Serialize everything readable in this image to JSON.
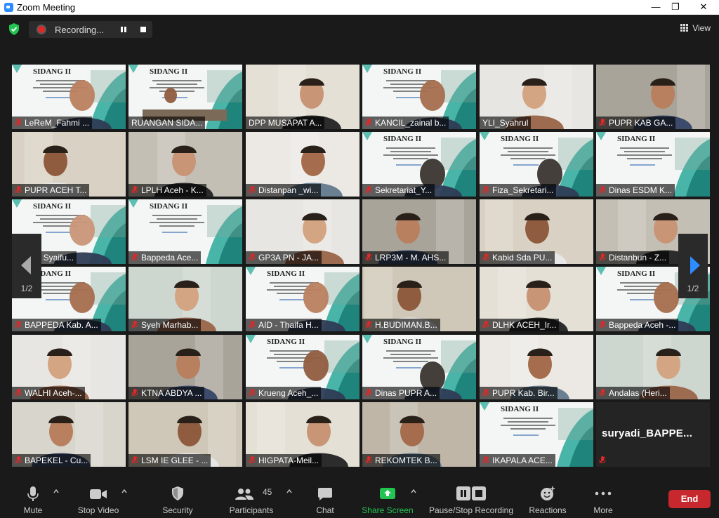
{
  "window": {
    "title": "Zoom Meeting",
    "minimize": "—",
    "maximize": "❐",
    "close": "✕"
  },
  "topbar": {
    "recording": "Recording...",
    "view": "View"
  },
  "pager": {
    "left": "1/2",
    "right": "1/2"
  },
  "slide_text": "SIDANG II",
  "participants": [
    "LeReM_Fahmi ...",
    "RUANGAN SIDA...",
    "DPP MUSAPAT A...",
    "KANCIL_zainal b...",
    "YLI_Syahrul",
    "PUPR KAB GA...",
    "PUPR ACEH T...",
    "LPLH Aceh - K...",
    "Distanpan _wi...",
    "Sekretariat_Y...",
    "Fiza_Sekretari...",
    "Dinas ESDM K...",
    "DA - Syaifu...",
    "Bappeda Ace...",
    "GP3A PN - JA...",
    "LRP3M - M. AHS...",
    "Kabid Sda PU...",
    "Distanbun - Z...",
    "BAPPEDA Kab. A...",
    "Syeh Marhab...",
    "AID - Thaifa H...",
    "H.BUDIMAN.B...",
    "DLHK ACEH_Ir...",
    "Bappeda Aceh -...",
    "WALHI Aceh-...",
    "KTNA ABDYA ...",
    "Krueng Aceh_...",
    "Dinas PUPR A...",
    "PUPR Kab. Bir...",
    "Andalas (Heri...",
    "BAPEKEL - Cu...",
    "LSM IE GLEE - ...",
    "HIGPATA-Meil...",
    "REKOMTEK B...",
    "IKAPALA ACE...",
    "suryadi_BAPPE..."
  ],
  "toolbar": {
    "mute": "Mute",
    "stop_video": "Stop Video",
    "security": "Security",
    "participants": "Participants",
    "participants_count": "45",
    "chat": "Chat",
    "share_screen": "Share Screen",
    "recording": "Pause/Stop Recording",
    "reactions": "Reactions",
    "more": "More",
    "end": "End"
  },
  "colors": {
    "active_border": "#d7e84c",
    "share_green": "#23c552",
    "end_red": "#c6282e",
    "accent_blue": "#2d8cff"
  }
}
